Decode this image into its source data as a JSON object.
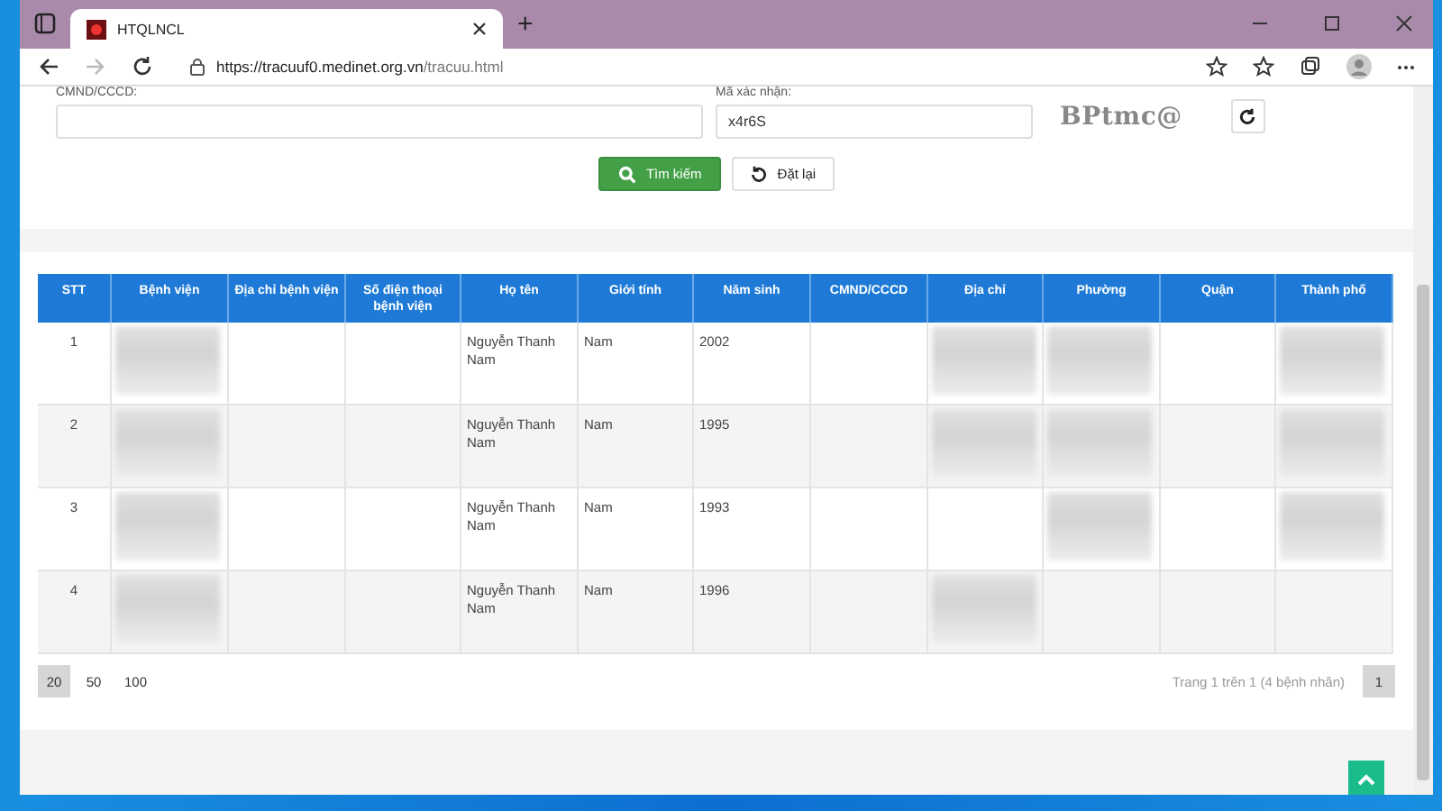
{
  "browser": {
    "tab_title": "HTQLNCL",
    "new_tab": "+",
    "url_host": "https://tracuuf0.medinet.org.vn",
    "url_path": "/tracuu.html"
  },
  "form": {
    "id_label": "CMND/CCCD:",
    "code_label": "Mã xác nhận:",
    "code_value": "x4r6S",
    "captcha": "BPtmc@",
    "search_button": "Tìm kiếm",
    "reset_button": "Đặt lại"
  },
  "table": {
    "columns": [
      "STT",
      "Bệnh viện",
      "Địa chỉ bệnh viện",
      "Số điện thoại bệnh viện",
      "Họ tên",
      "Giới tính",
      "Năm sinh",
      "CMND/CCCD",
      "Địa chỉ",
      "Phường",
      "Quận",
      "Thành phố"
    ],
    "rows": [
      {
        "cells": [
          {
            "kind": "center",
            "text": "1"
          },
          {
            "kind": "redacted"
          },
          {
            "kind": "empty"
          },
          {
            "kind": "empty"
          },
          {
            "kind": "text",
            "text": "Nguyễn Thanh Nam"
          },
          {
            "kind": "text",
            "text": "Nam"
          },
          {
            "kind": "text",
            "text": "2002"
          },
          {
            "kind": "empty"
          },
          {
            "kind": "redacted"
          },
          {
            "kind": "redacted"
          },
          {
            "kind": "empty"
          },
          {
            "kind": "redacted"
          }
        ]
      },
      {
        "cells": [
          {
            "kind": "center",
            "text": "2"
          },
          {
            "kind": "redacted"
          },
          {
            "kind": "empty"
          },
          {
            "kind": "empty"
          },
          {
            "kind": "text",
            "text": "Nguyễn Thanh Nam"
          },
          {
            "kind": "text",
            "text": "Nam"
          },
          {
            "kind": "text",
            "text": "1995"
          },
          {
            "kind": "empty"
          },
          {
            "kind": "redacted"
          },
          {
            "kind": "redacted"
          },
          {
            "kind": "empty"
          },
          {
            "kind": "redacted"
          }
        ]
      },
      {
        "cells": [
          {
            "kind": "center",
            "text": "3"
          },
          {
            "kind": "redacted"
          },
          {
            "kind": "empty"
          },
          {
            "kind": "empty"
          },
          {
            "kind": "text",
            "text": "Nguyễn Thanh Nam"
          },
          {
            "kind": "text",
            "text": "Nam"
          },
          {
            "kind": "text",
            "text": "1993"
          },
          {
            "kind": "empty"
          },
          {
            "kind": "empty"
          },
          {
            "kind": "redacted"
          },
          {
            "kind": "empty"
          },
          {
            "kind": "redacted"
          }
        ]
      },
      {
        "cells": [
          {
            "kind": "center",
            "text": "4"
          },
          {
            "kind": "redacted"
          },
          {
            "kind": "empty"
          },
          {
            "kind": "empty"
          },
          {
            "kind": "text",
            "text": "Nguyễn Thanh Nam"
          },
          {
            "kind": "text",
            "text": "Nam"
          },
          {
            "kind": "text",
            "text": "1996"
          },
          {
            "kind": "empty"
          },
          {
            "kind": "redacted"
          },
          {
            "kind": "empty"
          },
          {
            "kind": "empty"
          },
          {
            "kind": "empty"
          }
        ]
      }
    ]
  },
  "page_sizes": [
    {
      "label": "20",
      "selected": true
    },
    {
      "label": "50",
      "selected": false
    },
    {
      "label": "100",
      "selected": false
    }
  ],
  "page_info": "Trang 1 trên 1 (4 bệnh nhân)",
  "pages": [
    {
      "label": "1",
      "selected": true
    }
  ]
}
